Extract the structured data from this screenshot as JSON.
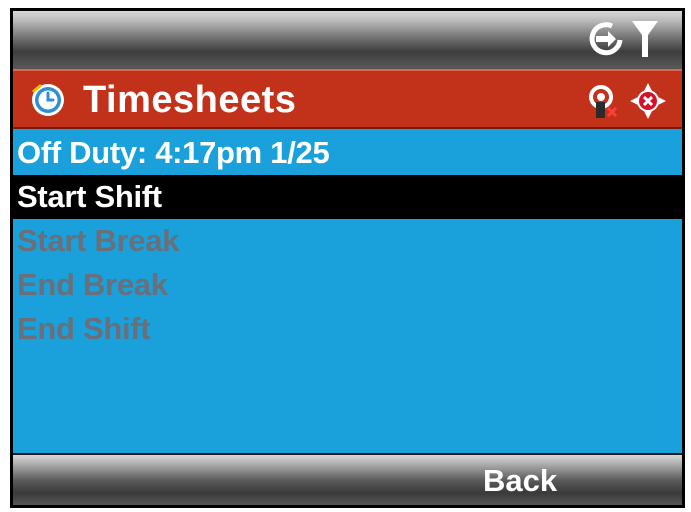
{
  "status_bar": {
    "icons": [
      "data-sync-icon",
      "signal-antenna-icon"
    ]
  },
  "title_bar": {
    "app_icon": "clock-icon",
    "title": "Timesheets",
    "icons": [
      "notification-blocked-icon",
      "gps-off-icon"
    ],
    "colors": {
      "background": "#c2321a",
      "text": "#ffffff"
    }
  },
  "list": {
    "items": [
      {
        "label": "Off Duty: 4:17pm 1/25",
        "state": "info"
      },
      {
        "label": "Start Shift",
        "state": "selected"
      },
      {
        "label": "Start Break",
        "state": "disabled"
      },
      {
        "label": "End Break",
        "state": "disabled"
      },
      {
        "label": "End Shift",
        "state": "disabled"
      }
    ],
    "colors": {
      "background": "#1aa0da",
      "selected": "#000000",
      "disabled_text": "#6a6f7a"
    }
  },
  "softkeys": {
    "left": "",
    "right": "Back"
  }
}
